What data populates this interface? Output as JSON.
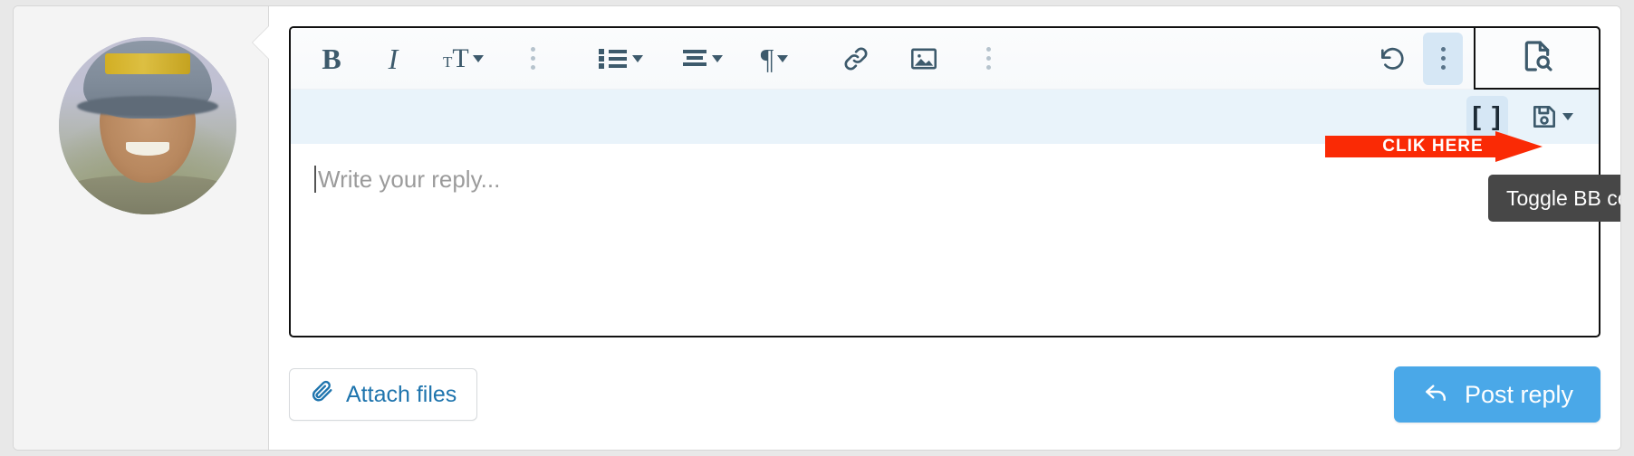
{
  "editor": {
    "placeholder": "Write your reply...",
    "content": "",
    "toolbar_row1": [
      {
        "name": "bold-button",
        "icon": "bold-icon",
        "label": "B",
        "has_caret": false
      },
      {
        "name": "italic-button",
        "icon": "italic-icon",
        "label": "I",
        "has_caret": false
      },
      {
        "name": "font-size-button",
        "icon": "font-size-icon",
        "label": "TT",
        "has_caret": true
      },
      {
        "name": "more-text-options-button",
        "icon": "vertical-dots-icon",
        "label": "",
        "has_caret": false
      },
      {
        "name": "list-button",
        "icon": "bulleted-list-icon",
        "label": "",
        "has_caret": true
      },
      {
        "name": "align-button",
        "icon": "text-align-icon",
        "label": "",
        "has_caret": true
      },
      {
        "name": "paragraph-button",
        "icon": "pilcrow-icon",
        "label": "¶",
        "has_caret": true
      },
      {
        "name": "insert-link-button",
        "icon": "link-icon",
        "label": "",
        "has_caret": false
      },
      {
        "name": "insert-image-button",
        "icon": "image-icon",
        "label": "",
        "has_caret": false
      },
      {
        "name": "more-insert-options-button",
        "icon": "vertical-dots-icon",
        "label": "",
        "has_caret": false
      }
    ],
    "toolbar_row1_right": [
      {
        "name": "undo-button",
        "icon": "undo-icon",
        "active": false
      },
      {
        "name": "more-options-button",
        "icon": "vertical-dots-icon",
        "active": true
      }
    ],
    "preview_button": {
      "name": "preview-button",
      "icon": "document-preview-icon"
    },
    "toolbar_row2_right": [
      {
        "name": "toggle-bb-code-button",
        "icon": "bb-code-brackets-icon",
        "label": "[ ]",
        "active": true,
        "has_caret": false
      },
      {
        "name": "draft-save-button",
        "icon": "floppy-save-icon",
        "label": "",
        "active": false,
        "has_caret": true
      }
    ]
  },
  "tooltip": {
    "text": "Toggle BB code"
  },
  "annotation": {
    "label": "CLIK HERE",
    "color": "#fa2a05",
    "text_color": "#ffffff",
    "points_at": "toggle-bb-code-button"
  },
  "footer": {
    "attach_label": "Attach files",
    "attach_icon": "paperclip-icon",
    "post_label": "Post reply",
    "post_icon": "reply-arrow-icon"
  },
  "author": {
    "avatar_name": "user-avatar",
    "avatar_alt": "Profile photo of a smiling man wearing a cap"
  },
  "colors": {
    "accent": "#4aa8e8",
    "link": "#1e74ad",
    "toolbar_icon": "#3d5a6c",
    "row2_background": "#e9f3fa",
    "active_button_background": "#d6e7f5",
    "tooltip_background": "#474747",
    "annotation_red": "#fa2a05",
    "page_background": "#e8e8e8",
    "author_column_background": "#f4f4f4"
  }
}
